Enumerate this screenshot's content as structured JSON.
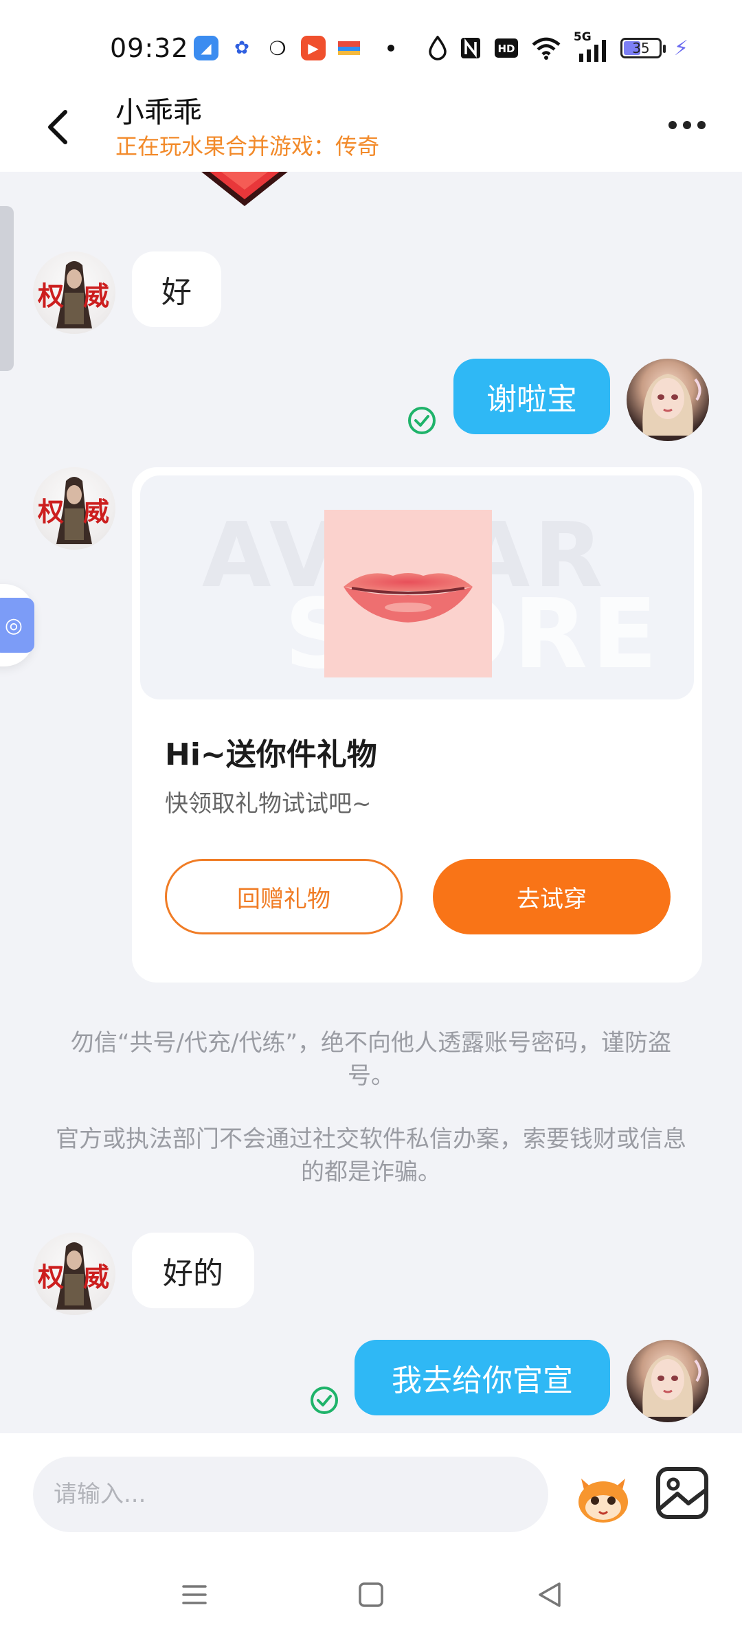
{
  "status_bar": {
    "time": "09:32",
    "network": "5G",
    "battery": "35"
  },
  "header": {
    "title": "小乖乖",
    "subtitle": "正在玩水果合并游戏：传奇"
  },
  "messages": {
    "m1": "好",
    "m2": "谢啦宝",
    "m3": "好的",
    "m4": "我去给你官宣"
  },
  "gift_card": {
    "watermark_1": "AVATAR",
    "watermark_2": "STORE",
    "title": "Hi~送你件礼物",
    "subtitle": "快领取礼物试试吧~",
    "return_button": "回赠礼物",
    "try_button": "去试穿"
  },
  "notices": [
    "勿信“共号/代充/代练”，绝不向他人透露账号密码，谨防盗号。",
    "官方或执法部门不会通过社交软件私信办案，索要钱财或信息的都是诈骗。"
  ],
  "input": {
    "placeholder": "请输入..."
  },
  "colors": {
    "accent_orange": "#f97417",
    "outgoing_bubble": "#2fb8f5",
    "subtitle_orange": "#f28a2a"
  }
}
